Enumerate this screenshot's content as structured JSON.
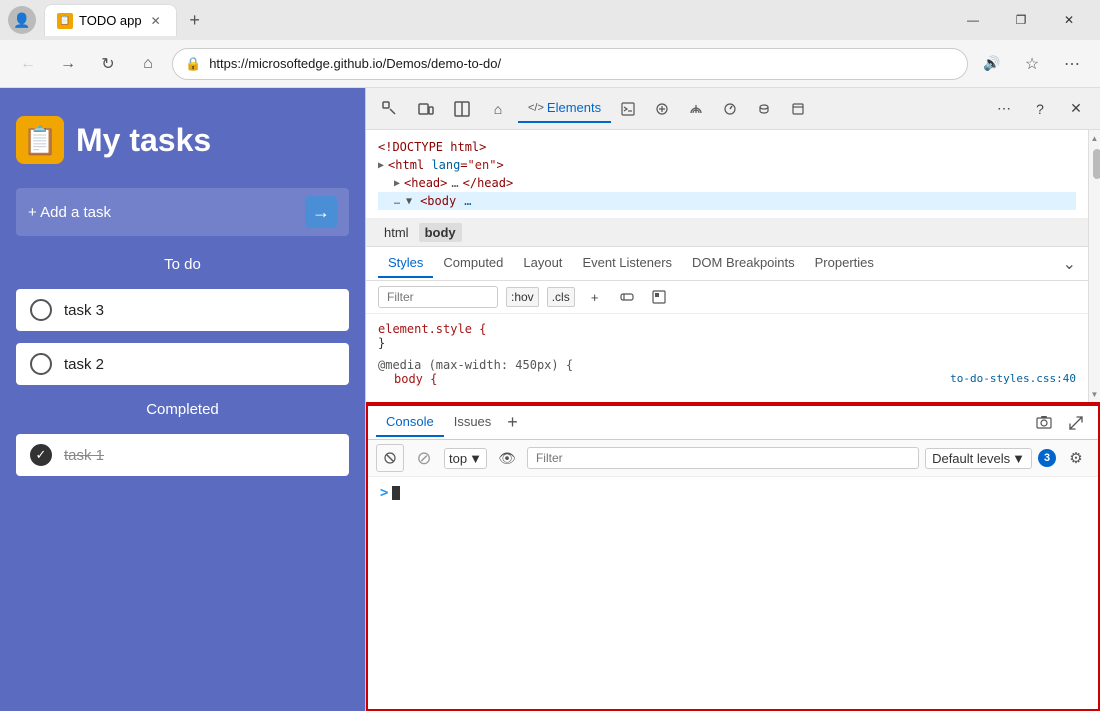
{
  "browser": {
    "title": "TODO app",
    "url": "https://microsoftedge.github.io/Demos/demo-to-do/",
    "tab_favicon": "📋",
    "window_controls": {
      "minimize": "—",
      "maximize": "❐",
      "close": "✕"
    }
  },
  "devtools": {
    "panels": [
      "inspect",
      "device",
      "toggle",
      "Elements",
      "console-panel",
      "sources",
      "network",
      "performance",
      "memory",
      "application",
      "more",
      "help",
      "close"
    ],
    "active_panel": "Elements",
    "elements_tab_label": "Elements",
    "breadcrumb": [
      "html",
      "body"
    ],
    "subtabs": [
      "Styles",
      "Computed",
      "Layout",
      "Event Listeners",
      "DOM Breakpoints",
      "Properties"
    ],
    "active_subtab": "Styles",
    "filter_placeholder": "Filter",
    "pseudo_hov": ":hov",
    "pseudo_cls": ".cls",
    "html_tree": [
      "<!DOCTYPE html>",
      "<html lang=\"en\">",
      "  <head> … </head>",
      "  ▶ <body … >"
    ],
    "css_rules": [
      {
        "selector": "element.style {",
        "close": "}",
        "properties": []
      },
      {
        "media": "@media (max-width: 450px) {",
        "selector": "  body {",
        "close": "  }",
        "source": "to-do-styles.css:40",
        "properties": []
      }
    ],
    "console": {
      "tabs": [
        "Console",
        "Issues"
      ],
      "add_label": "+",
      "level_label": "Default levels",
      "badge_count": "3",
      "filter_placeholder": "Filter",
      "context": "top",
      "prompt_symbol": ">",
      "cursor_visible": true
    }
  },
  "todo": {
    "title": "My tasks",
    "icon": "📋",
    "add_placeholder": "+ Add a task",
    "sections": {
      "todo_label": "To do",
      "completed_label": "Completed"
    },
    "tasks_todo": [
      {
        "id": "task3",
        "text": "task 3",
        "done": false
      },
      {
        "id": "task2",
        "text": "task 2",
        "done": false
      }
    ],
    "tasks_done": [
      {
        "id": "task1",
        "text": "task 1",
        "done": true
      }
    ]
  }
}
